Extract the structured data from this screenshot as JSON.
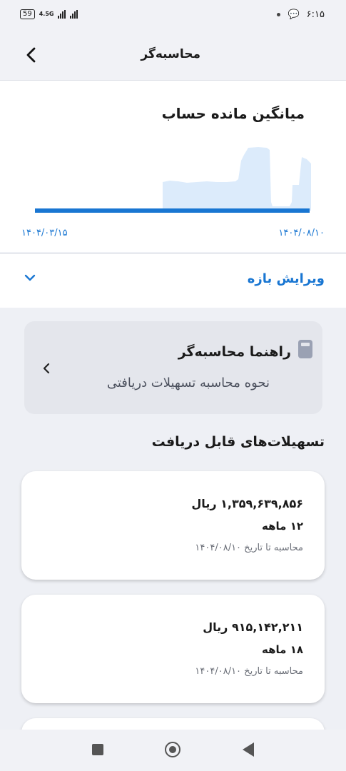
{
  "status_bar": {
    "battery": "59",
    "network": "4.5G",
    "time": "۶:۱۵"
  },
  "app_bar": {
    "title": "محاسبه‌گر"
  },
  "balance_chart": {
    "title": "میانگین مانده حساب",
    "start_date": "۱۴۰۴/۰۳/۱۵",
    "end_date": "۱۴۰۴/۰۸/۱۰",
    "colors": {
      "line": "#1976d2",
      "area": "#dcebfb"
    }
  },
  "range_edit": {
    "label": "ویرایش بازه"
  },
  "guide": {
    "title": "راهنما محاسبه‌گر",
    "subtitle": "نحوه محاسبه تسهیلات دریافتی"
  },
  "loans_section": {
    "title": "تسهیلات‌های قابل دریافت"
  },
  "loans": [
    {
      "amount": "۱,۳۵۹,۶۳۹,۸۵۶ ریال",
      "term": "۱۲ ماهه",
      "calc_date": "محاسبه تا تاریخ ۱۴۰۴/۰۸/۱۰"
    },
    {
      "amount": "۹۱۵,۱۴۲,۲۱۱ ریال",
      "term": "۱۸ ماهه",
      "calc_date": "محاسبه تا تاریخ ۱۴۰۴/۰۸/۱۰"
    }
  ]
}
